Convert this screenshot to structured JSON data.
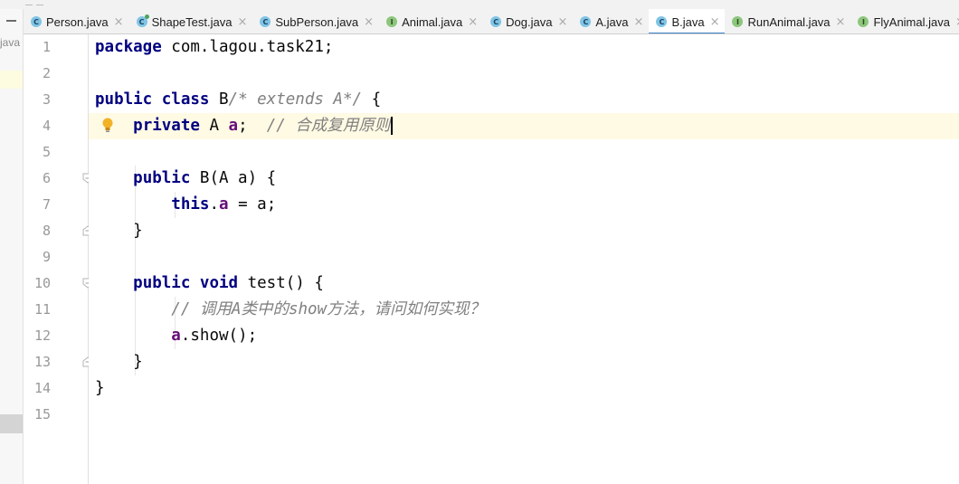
{
  "tabs": [
    {
      "label": "Person.java",
      "icon": "class-icon",
      "kind": "c",
      "active": false
    },
    {
      "label": "ShapeTest.java",
      "icon": "runnable-class-icon",
      "kind": "r",
      "active": false
    },
    {
      "label": "SubPerson.java",
      "icon": "class-icon",
      "kind": "c",
      "active": false
    },
    {
      "label": "Animal.java",
      "icon": "interface-icon",
      "kind": "i",
      "active": false
    },
    {
      "label": "Dog.java",
      "icon": "class-icon",
      "kind": "c",
      "active": false
    },
    {
      "label": "A.java",
      "icon": "class-icon",
      "kind": "c",
      "active": false
    },
    {
      "label": "B.java",
      "icon": "class-icon",
      "kind": "c",
      "active": true
    },
    {
      "label": "RunAnimal.java",
      "icon": "interface-icon",
      "kind": "i",
      "active": false
    },
    {
      "label": "FlyAnimal.java",
      "icon": "interface-icon",
      "kind": "i",
      "active": false
    }
  ],
  "tab_close_glyph": "×",
  "project_panel": {
    "truncated_label": "java"
  },
  "colors": {
    "keyword": "#000080",
    "field": "#660e7a",
    "comment": "#808080",
    "caret_line": "#fffae3",
    "active_tab_underline": "#4083c9"
  },
  "editor": {
    "current_line": 4,
    "line_numbers": [
      "1",
      "2",
      "3",
      "4",
      "5",
      "6",
      "7",
      "8",
      "9",
      "10",
      "11",
      "12",
      "13",
      "14",
      "15"
    ],
    "lines": [
      [
        {
          "t": "package",
          "k": "kw"
        },
        {
          "t": " com.lagou.task21;"
        }
      ],
      [],
      [
        {
          "t": "public",
          "k": "kw"
        },
        {
          "t": " "
        },
        {
          "t": "class",
          "k": "kw"
        },
        {
          "t": " B"
        },
        {
          "t": "/* extends A*/",
          "k": "cmt"
        },
        {
          "t": " {"
        }
      ],
      [
        {
          "t": "    "
        },
        {
          "t": "private",
          "k": "kw"
        },
        {
          "t": " A "
        },
        {
          "t": "a",
          "k": "fld"
        },
        {
          "t": ";  "
        },
        {
          "t": "// 合成复用原则",
          "k": "cmt"
        }
      ],
      [],
      [
        {
          "t": "    "
        },
        {
          "t": "public",
          "k": "kw"
        },
        {
          "t": " B(A a) {"
        }
      ],
      [
        {
          "t": "        "
        },
        {
          "t": "this",
          "k": "kw"
        },
        {
          "t": "."
        },
        {
          "t": "a",
          "k": "fld"
        },
        {
          "t": " = a;"
        }
      ],
      [
        {
          "t": "    }"
        }
      ],
      [],
      [
        {
          "t": "    "
        },
        {
          "t": "public",
          "k": "kw"
        },
        {
          "t": " "
        },
        {
          "t": "void",
          "k": "kw"
        },
        {
          "t": " test() {"
        }
      ],
      [
        {
          "t": "        "
        },
        {
          "t": "// 调用A类中的show方法，请问如何实现？",
          "k": "cmt"
        }
      ],
      [
        {
          "t": "        "
        },
        {
          "t": "a",
          "k": "fld"
        },
        {
          "t": ".show();"
        }
      ],
      [
        {
          "t": "    }"
        }
      ],
      [
        {
          "t": "}"
        }
      ],
      []
    ]
  }
}
